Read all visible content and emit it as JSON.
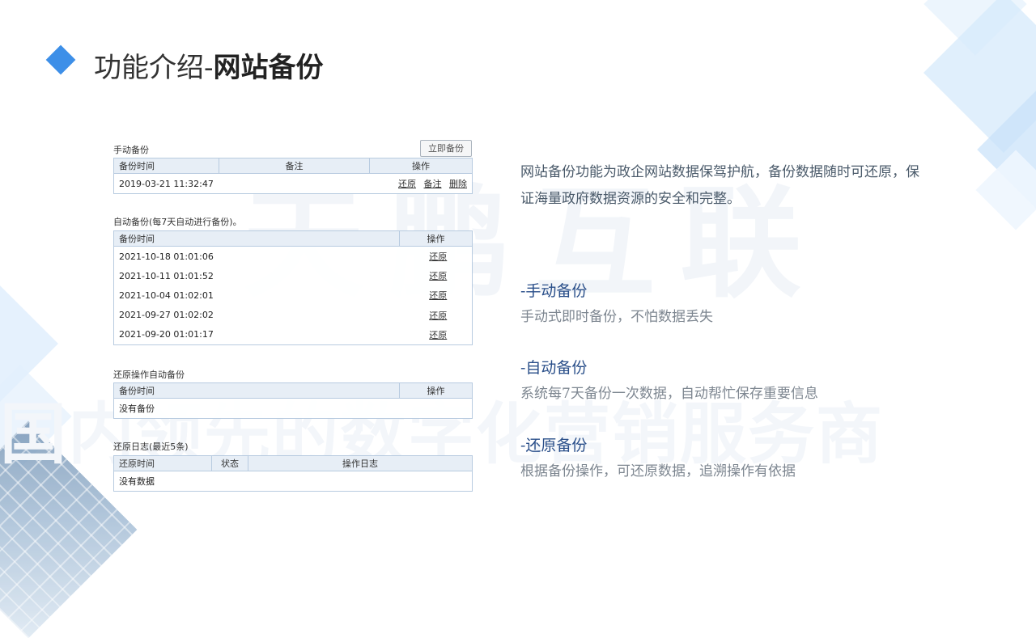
{
  "title": {
    "prefix": "功能介绍-",
    "emphasis": "网站备份"
  },
  "watermark": {
    "line1": "天鹏互联",
    "line2": "国内领先的数字化营销服务商"
  },
  "manual": {
    "heading": "手动备份",
    "button": "立即备份",
    "columns": [
      "备份时间",
      "备注",
      "操作"
    ],
    "rows": [
      {
        "time": "2019-03-21 11:32:47",
        "note": "",
        "actions": [
          "还原",
          "备注",
          "删除"
        ]
      }
    ]
  },
  "auto": {
    "heading": "自动备份(每7天自动进行备份)。",
    "columns": [
      "备份时间",
      "操作"
    ],
    "rows": [
      {
        "time": "2021-10-18 01:01:06",
        "action": "还原"
      },
      {
        "time": "2021-10-11 01:01:52",
        "action": "还原"
      },
      {
        "time": "2021-10-04 01:02:01",
        "action": "还原"
      },
      {
        "time": "2021-09-27 01:02:02",
        "action": "还原"
      },
      {
        "time": "2021-09-20 01:01:17",
        "action": "还原"
      }
    ]
  },
  "restore_auto": {
    "heading": "还原操作自动备份",
    "columns": [
      "备份时间",
      "操作"
    ],
    "empty": "没有备份"
  },
  "restore_log": {
    "heading": "还原日志(最近5条)",
    "columns": [
      "还原时间",
      "状态",
      "操作日志"
    ],
    "empty": "没有数据"
  },
  "description": "网站备份功能为政企网站数据保驾护航，备份数据随时可还原，保证海量政府数据资源的安全和完整。",
  "features": [
    {
      "title": "-手动备份",
      "text": "手动式即时备份，不怕数据丢失"
    },
    {
      "title": "-自动备份",
      "text": "系统每7天备份一次数据，自动帮忙保存重要信息"
    },
    {
      "title": "-还原备份",
      "text": "根据备份操作，可还原数据，追溯操作有依据"
    }
  ],
  "colors": {
    "accent": "#3d8fe8",
    "feature_title": "#2a4f8a",
    "table_header": "#e7eef6"
  }
}
